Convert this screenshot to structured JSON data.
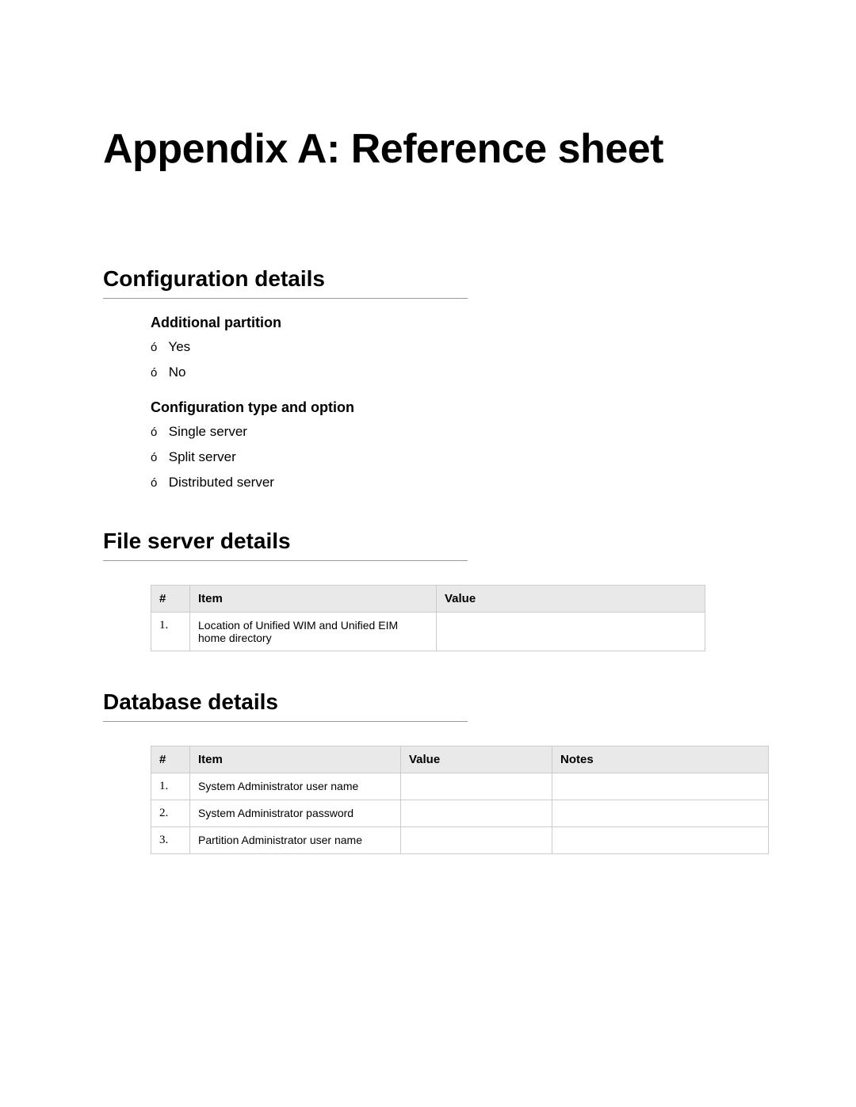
{
  "title": "Appendix A: Reference sheet",
  "sections": {
    "config": {
      "heading": "Configuration details",
      "partition": {
        "heading": "Additional partition",
        "options": [
          "Yes",
          "No"
        ]
      },
      "type": {
        "heading": "Configuration type and option",
        "options": [
          "Single server",
          "Split server",
          "Distributed server"
        ]
      }
    },
    "file_server": {
      "heading": "File server details",
      "columns": [
        "#",
        "Item",
        "Value"
      ],
      "rows": [
        {
          "num": "1.",
          "item": "Location of Unified WIM and Unified EIM home directory",
          "value": ""
        }
      ]
    },
    "database": {
      "heading": "Database details",
      "columns": [
        "#",
        "Item",
        "Value",
        "Notes"
      ],
      "rows": [
        {
          "num": "1.",
          "item": "System Administrator user name",
          "value": "",
          "notes": ""
        },
        {
          "num": "2.",
          "item": "System Administrator password",
          "value": "",
          "notes": ""
        },
        {
          "num": "3.",
          "item": "Partition Administrator user name",
          "value": "",
          "notes": ""
        }
      ]
    }
  },
  "bullet": "ó"
}
